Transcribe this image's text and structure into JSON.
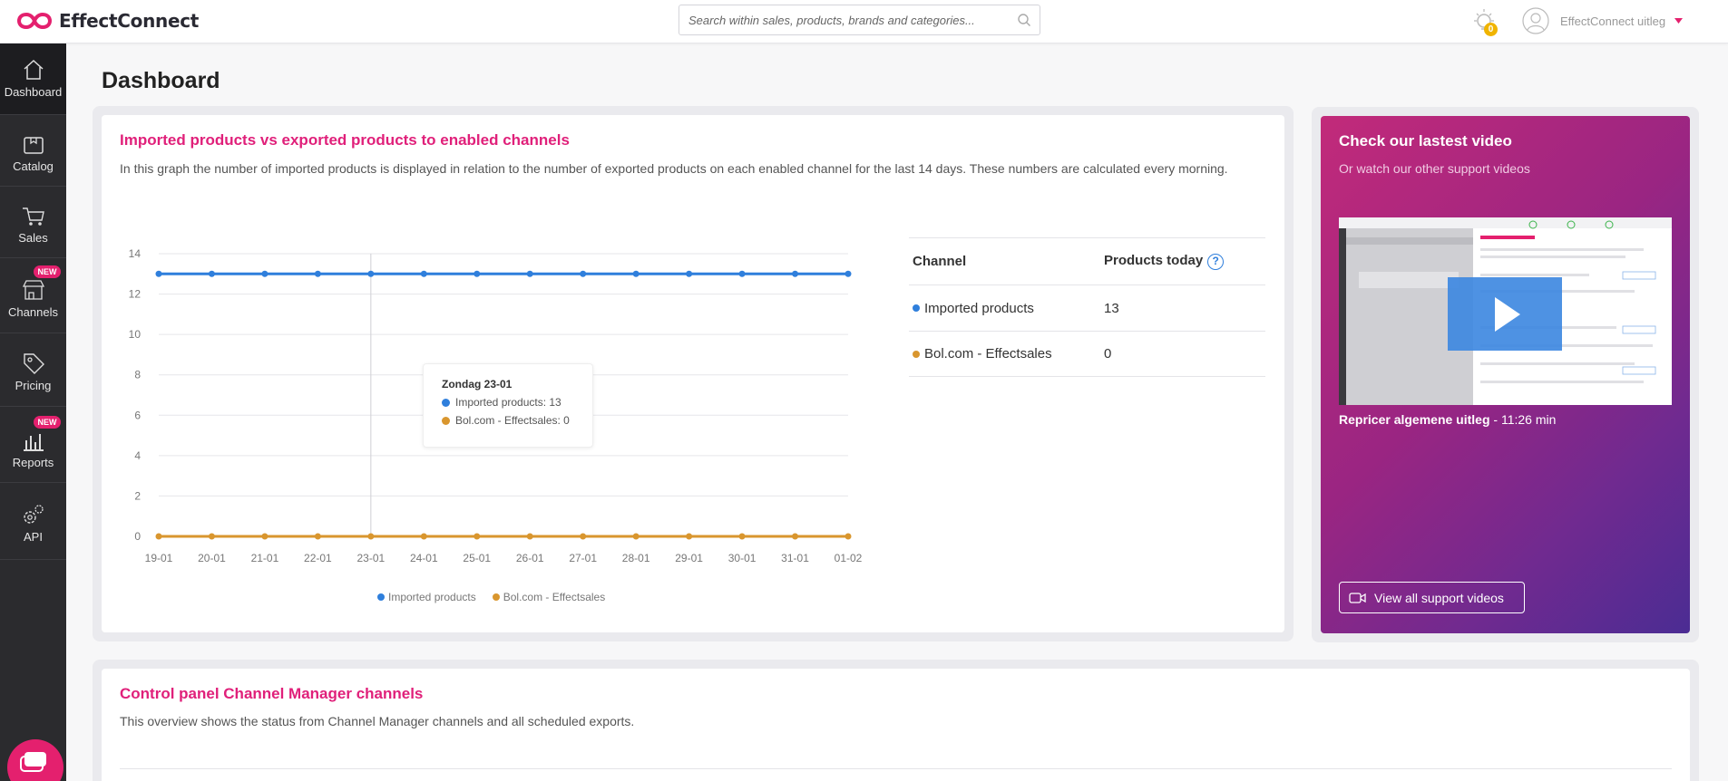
{
  "header": {
    "brand": "EffectConnect",
    "search_placeholder": "Search within sales, products, brands and categories...",
    "notifications_count": "0",
    "user_name": "EffectConnect uitleg"
  },
  "sidebar": {
    "items": [
      {
        "label": "Dashboard",
        "icon": "home-icon",
        "active": true,
        "badge": ""
      },
      {
        "label": "Catalog",
        "icon": "box-icon",
        "active": false,
        "badge": ""
      },
      {
        "label": "Sales",
        "icon": "cart-icon",
        "active": false,
        "badge": ""
      },
      {
        "label": "Channels",
        "icon": "store-icon",
        "active": false,
        "badge": "NEW"
      },
      {
        "label": "Pricing",
        "icon": "price-tag-icon",
        "active": false,
        "badge": ""
      },
      {
        "label": "Reports",
        "icon": "bar-chart-icon",
        "active": false,
        "badge": "NEW"
      },
      {
        "label": "API",
        "icon": "gears-icon",
        "active": false,
        "badge": ""
      }
    ]
  },
  "page": {
    "title": "Dashboard"
  },
  "graph_card": {
    "title": "Imported products vs exported products to enabled channels",
    "description": "In this graph the number of imported products is displayed in relation to the number of exported products on each enabled channel for the last 14 days. These numbers are calculated every morning.",
    "tooltip": {
      "title": "Zondag 23-01",
      "rows": [
        "Imported products: 13",
        "Bol.com - Effectsales: 0"
      ]
    },
    "table": {
      "headers": [
        "Channel",
        "Products today"
      ],
      "help_symbol": "?",
      "rows": [
        {
          "channel": "Imported products",
          "value": "13",
          "color": "#2f7fdc"
        },
        {
          "channel": "Bol.com - Effectsales",
          "value": "0",
          "color": "#d9962e"
        }
      ]
    }
  },
  "chart_data": {
    "type": "line",
    "x": [
      "19-01",
      "20-01",
      "21-01",
      "22-01",
      "23-01",
      "24-01",
      "25-01",
      "26-01",
      "27-01",
      "28-01",
      "29-01",
      "30-01",
      "31-01",
      "01-02"
    ],
    "series": [
      {
        "name": "Imported products",
        "color": "#2f7fdc",
        "values": [
          13,
          13,
          13,
          13,
          13,
          13,
          13,
          13,
          13,
          13,
          13,
          13,
          13,
          13
        ]
      },
      {
        "name": "Bol.com - Effectsales",
        "color": "#d9962e",
        "values": [
          0,
          0,
          0,
          0,
          0,
          0,
          0,
          0,
          0,
          0,
          0,
          0,
          0,
          0
        ]
      }
    ],
    "ylim": [
      0,
      14
    ],
    "yticks": [
      0,
      2,
      4,
      6,
      8,
      10,
      12,
      14
    ],
    "grid": true,
    "legend": "bottom",
    "highlighted_x": "23-01"
  },
  "video_card": {
    "title": "Check our lastest video",
    "subtitle": "Or watch our other support videos",
    "video_title": "Repricer algemene uitleg",
    "video_duration": " - 11:26 min",
    "button_label": "View all support videos"
  },
  "control_card": {
    "title": "Control panel Channel Manager channels",
    "description": "This overview shows the status from Channel Manager channels and all scheduled exports."
  }
}
